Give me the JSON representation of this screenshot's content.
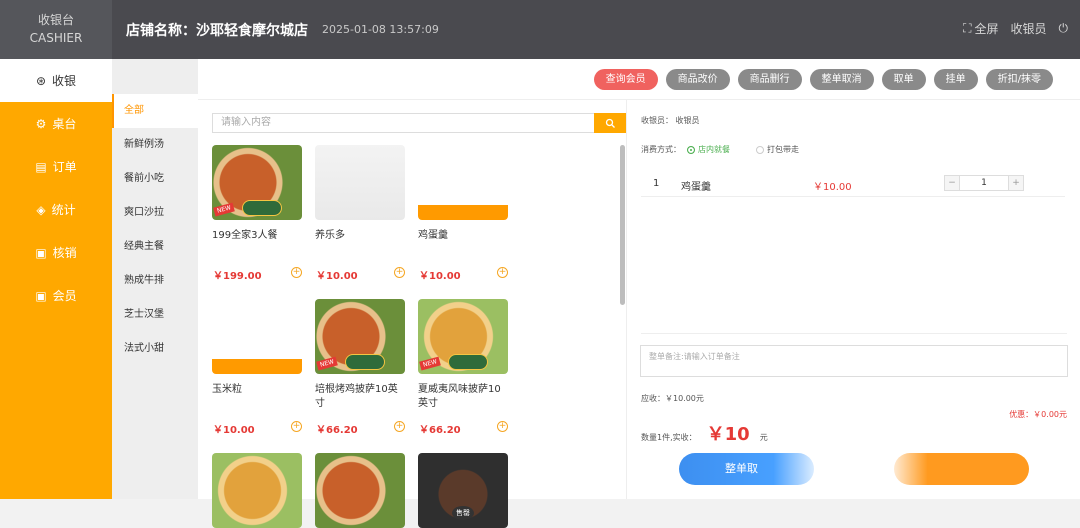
{
  "header": {
    "brand_cn": "收银台",
    "brand_en": "CASHIER",
    "store_name": "店铺名称：沙耶轻食摩尔城店",
    "datetime": "2025-01-08 13:57:09",
    "fullscreen_label": "全屏",
    "user_label": "收银员"
  },
  "nav": [
    {
      "label": "收银",
      "icon": "cashier-icon"
    },
    {
      "label": "桌台",
      "icon": "table-icon"
    },
    {
      "label": "订单",
      "icon": "order-icon"
    },
    {
      "label": "统计",
      "icon": "stats-icon"
    },
    {
      "label": "核销",
      "icon": "verify-icon"
    },
    {
      "label": "会员",
      "icon": "member-icon"
    }
  ],
  "categories": [
    "全部",
    "新鲜例汤",
    "餐前小吃",
    "爽口沙拉",
    "经典主餐",
    "熟成牛排",
    "芝士汉堡",
    "法式小甜"
  ],
  "actions": [
    "查询会员",
    "商品改价",
    "商品删行",
    "整单取消",
    "取单",
    "挂单",
    "折扣/抹零"
  ],
  "search": {
    "placeholder": "请输入内容"
  },
  "products": [
    {
      "name": "199全家3人餐",
      "price": "￥199.00"
    },
    {
      "name": "养乐多",
      "price": "￥10.00"
    },
    {
      "name": "鸡蛋羹",
      "price": "￥10.00"
    },
    {
      "name": "玉米粒",
      "price": "￥10.00"
    },
    {
      "name": "培根烤鸡披萨10英寸",
      "price": "￥66.20"
    },
    {
      "name": "夏威夷风味披萨10英寸",
      "price": "￥66.20"
    }
  ],
  "badges": {
    "new": "NEW",
    "sold": "售罄"
  },
  "cart": {
    "cashier_label": "收银员：",
    "cashier_value": "收银员",
    "mode_label": "消费方式：",
    "mode_dinein": "店内就餐",
    "mode_takeaway": "打包带走",
    "items": [
      {
        "index": "1",
        "name": "鸡蛋羹",
        "price": "￥10.00",
        "qty": "1"
      }
    ],
    "note_placeholder": "整单备注:请输入订单备注",
    "receivable": "应收：￥10.00元",
    "discount": "优惠：￥0.00元",
    "paid_label": "数量1件,实收：",
    "paid_amount": "￥10",
    "paid_unit": "元",
    "checkout_label": "整单取"
  }
}
